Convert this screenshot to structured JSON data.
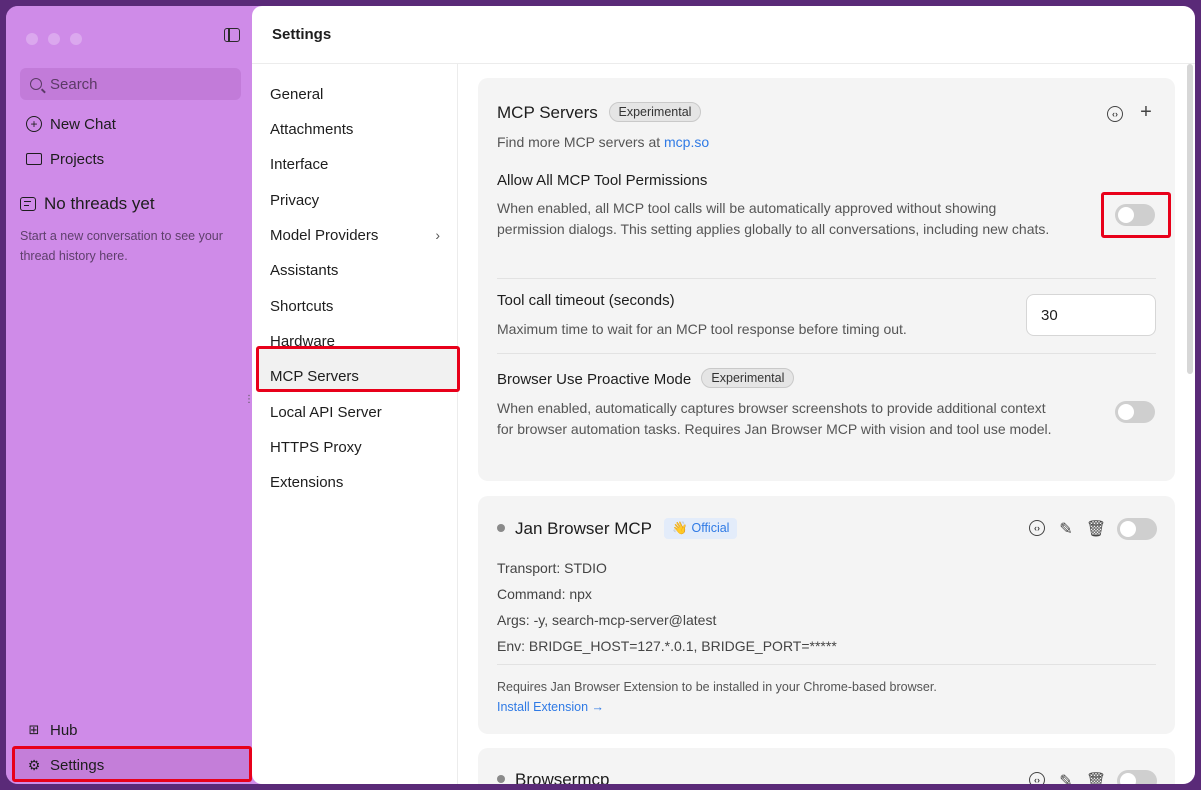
{
  "sidebar": {
    "search_placeholder": "Search",
    "new_chat": "New Chat",
    "projects": "Projects",
    "threads_title": "No threads yet",
    "threads_desc": "Start a new conversation to see your thread history here.",
    "hub": "Hub",
    "settings": "Settings"
  },
  "header": {
    "title": "Settings"
  },
  "subnav": {
    "items": [
      "General",
      "Attachments",
      "Interface",
      "Privacy",
      "Model Providers",
      "Assistants",
      "Shortcuts",
      "Hardware",
      "MCP Servers",
      "Local API Server",
      "HTTPS Proxy",
      "Extensions"
    ],
    "active": "MCP Servers"
  },
  "mcp": {
    "title": "MCP Servers",
    "badge": "Experimental",
    "find_more_prefix": "Find more MCP servers at",
    "find_more_link": "mcp.so",
    "allow_all_label": "Allow All MCP Tool Permissions",
    "allow_all_desc": "When enabled, all MCP tool calls will be automatically approved without showing permission dialogs. This setting applies globally to all conversations, including new chats.",
    "allow_all_enabled": false,
    "timeout_label": "Tool call timeout (seconds)",
    "timeout_desc": "Maximum time to wait for an MCP tool response before timing out.",
    "timeout_value": "30",
    "browser_label": "Browser Use Proactive Mode",
    "browser_badge": "Experimental",
    "browser_desc": "When enabled, automatically captures browser screenshots to provide additional context for browser automation tasks. Requires Jan Browser MCP with vision and tool use model.",
    "browser_enabled": false
  },
  "servers": [
    {
      "name": "Jan Browser MCP",
      "badge": "Official",
      "transport": "Transport: STDIO",
      "command": "Command: npx",
      "args": "Args: -y, search-mcp-server@latest",
      "env": "Env: BRIDGE_HOST=127.*.0.1, BRIDGE_PORT=*****",
      "note": "Requires Jan Browser Extension to be installed in your Chrome-based browser.",
      "install": "Install Extension →",
      "enabled": false
    },
    {
      "name": "Browsermcp",
      "enabled": false
    }
  ],
  "colors": {
    "sidebar": "#cf8be8",
    "highlight": "#e8001a",
    "link": "#2f7ae5"
  }
}
